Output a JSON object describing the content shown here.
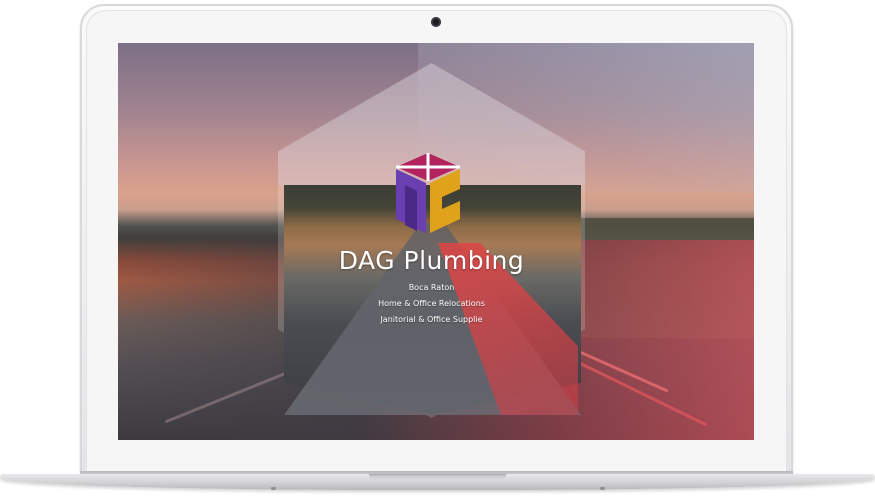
{
  "site": {
    "title": "DAG Plumbing",
    "taglines": [
      "Boca Raton",
      "Home & Office Relocations",
      "Janitorial & Office Supplie"
    ]
  },
  "logo": {
    "icon": "hc-cube-logo-icon",
    "colors": [
      "#b3235f",
      "#6a3fb0",
      "#e0a21b"
    ]
  },
  "device": {
    "type": "laptop",
    "icon": "camera-icon"
  }
}
